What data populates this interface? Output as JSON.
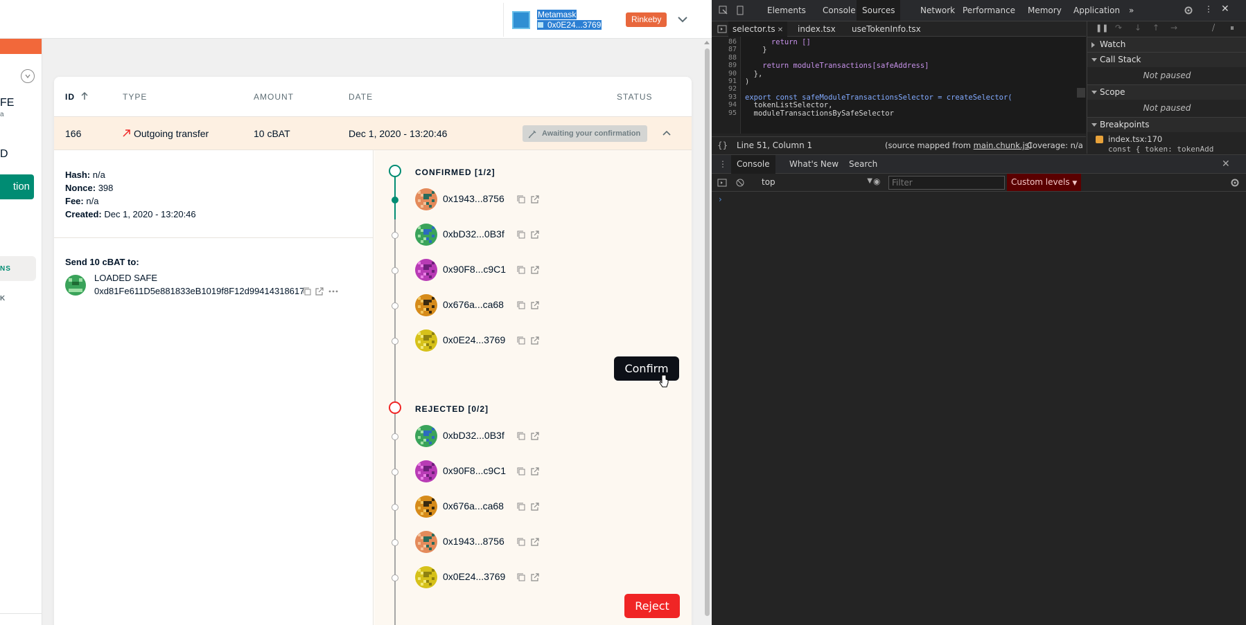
{
  "provider": {
    "name": "Metamask",
    "address": "0x0E24...3769",
    "network": "Rinkeby"
  },
  "sidebar": {
    "safe_fragment": "FE",
    "safe_fragment2": "a",
    "balance_fragment": "D",
    "new_tx_fragment": "tion",
    "nav_tx_fragment": "NS",
    "nav_ab_fragment": "K"
  },
  "table": {
    "headers": {
      "id": "ID",
      "type": "TYPE",
      "amount": "AMOUNT",
      "date": "DATE",
      "status": "STATUS"
    },
    "row": {
      "id": "166",
      "type": "Outgoing transfer",
      "amount": "10 cBAT",
      "date": "Dec 1, 2020 - 13:20:46",
      "status": "Awaiting your confirmation"
    }
  },
  "details": {
    "hash_label": "Hash:",
    "hash": "n/a",
    "nonce_label": "Nonce:",
    "nonce": "398",
    "fee_label": "Fee:",
    "fee": "n/a",
    "created_label": "Created:",
    "created": "Dec 1, 2020 - 13:20:46",
    "send_title": "Send 10 cBAT to:",
    "recipient_name": "LOADED SAFE",
    "recipient_address": "0xd81Fe611D5e881833eB1019f8F12d99414318617"
  },
  "owners": {
    "confirmed_title": "CONFIRMED [1/2]",
    "rejected_title": "REJECTED [0/2]",
    "confirmed": [
      {
        "address": "0x1943...8756"
      },
      {
        "address": "0xbD32...0B3f"
      },
      {
        "address": "0x90F8...c9C1"
      },
      {
        "address": "0x676a...ca68"
      },
      {
        "address": "0x0E24...3769"
      }
    ],
    "rejected": [
      {
        "address": "0xbD32...0B3f"
      },
      {
        "address": "0x90F8...c9C1"
      },
      {
        "address": "0x676a...ca68"
      },
      {
        "address": "0x1943...8756"
      },
      {
        "address": "0x0E24...3769"
      }
    ],
    "confirm_label": "Confirm",
    "reject_label": "Reject"
  },
  "devtools": {
    "tabs": [
      "Elements",
      "Console",
      "Sources",
      "Network",
      "Performance",
      "Memory",
      "Application"
    ],
    "active_tab": "Sources",
    "files": [
      "selector.ts",
      "index.tsx",
      "useTokenInfo.tsx"
    ],
    "code_lines": [
      {
        "n": "86",
        "text": "      return []"
      },
      {
        "n": "87",
        "text": "    }"
      },
      {
        "n": "88",
        "text": ""
      },
      {
        "n": "89",
        "text": "    return moduleTransactions[safeAddress]"
      },
      {
        "n": "90",
        "text": "  },"
      },
      {
        "n": "91",
        "text": ")"
      },
      {
        "n": "92",
        "text": ""
      },
      {
        "n": "93",
        "text": "export const safeModuleTransactionsSelector = createSelector("
      },
      {
        "n": "94",
        "text": "  tokenListSelector,"
      },
      {
        "n": "95",
        "text": "  moduleTransactionsBySafeSelector"
      }
    ],
    "position": "Line 51, Column 1",
    "source_mapped_prefix": "(source mapped from ",
    "source_mapped_file": "main.chunk.js",
    "source_mapped_suffix": ")",
    "coverage": "Coverage: n/a",
    "watch": "Watch",
    "call_stack": "Call Stack",
    "not_paused": "Not paused",
    "scope": "Scope",
    "not_paused2": "Not paused",
    "breakpoints": "Breakpoints",
    "breakpoint_file": "index.tsx:170",
    "breakpoint_code": "const { token: tokenAdd",
    "console_tabs": [
      "Console",
      "What's New",
      "Search"
    ],
    "context": "top",
    "filter_placeholder": "Filter",
    "levels": "Custom levels"
  }
}
